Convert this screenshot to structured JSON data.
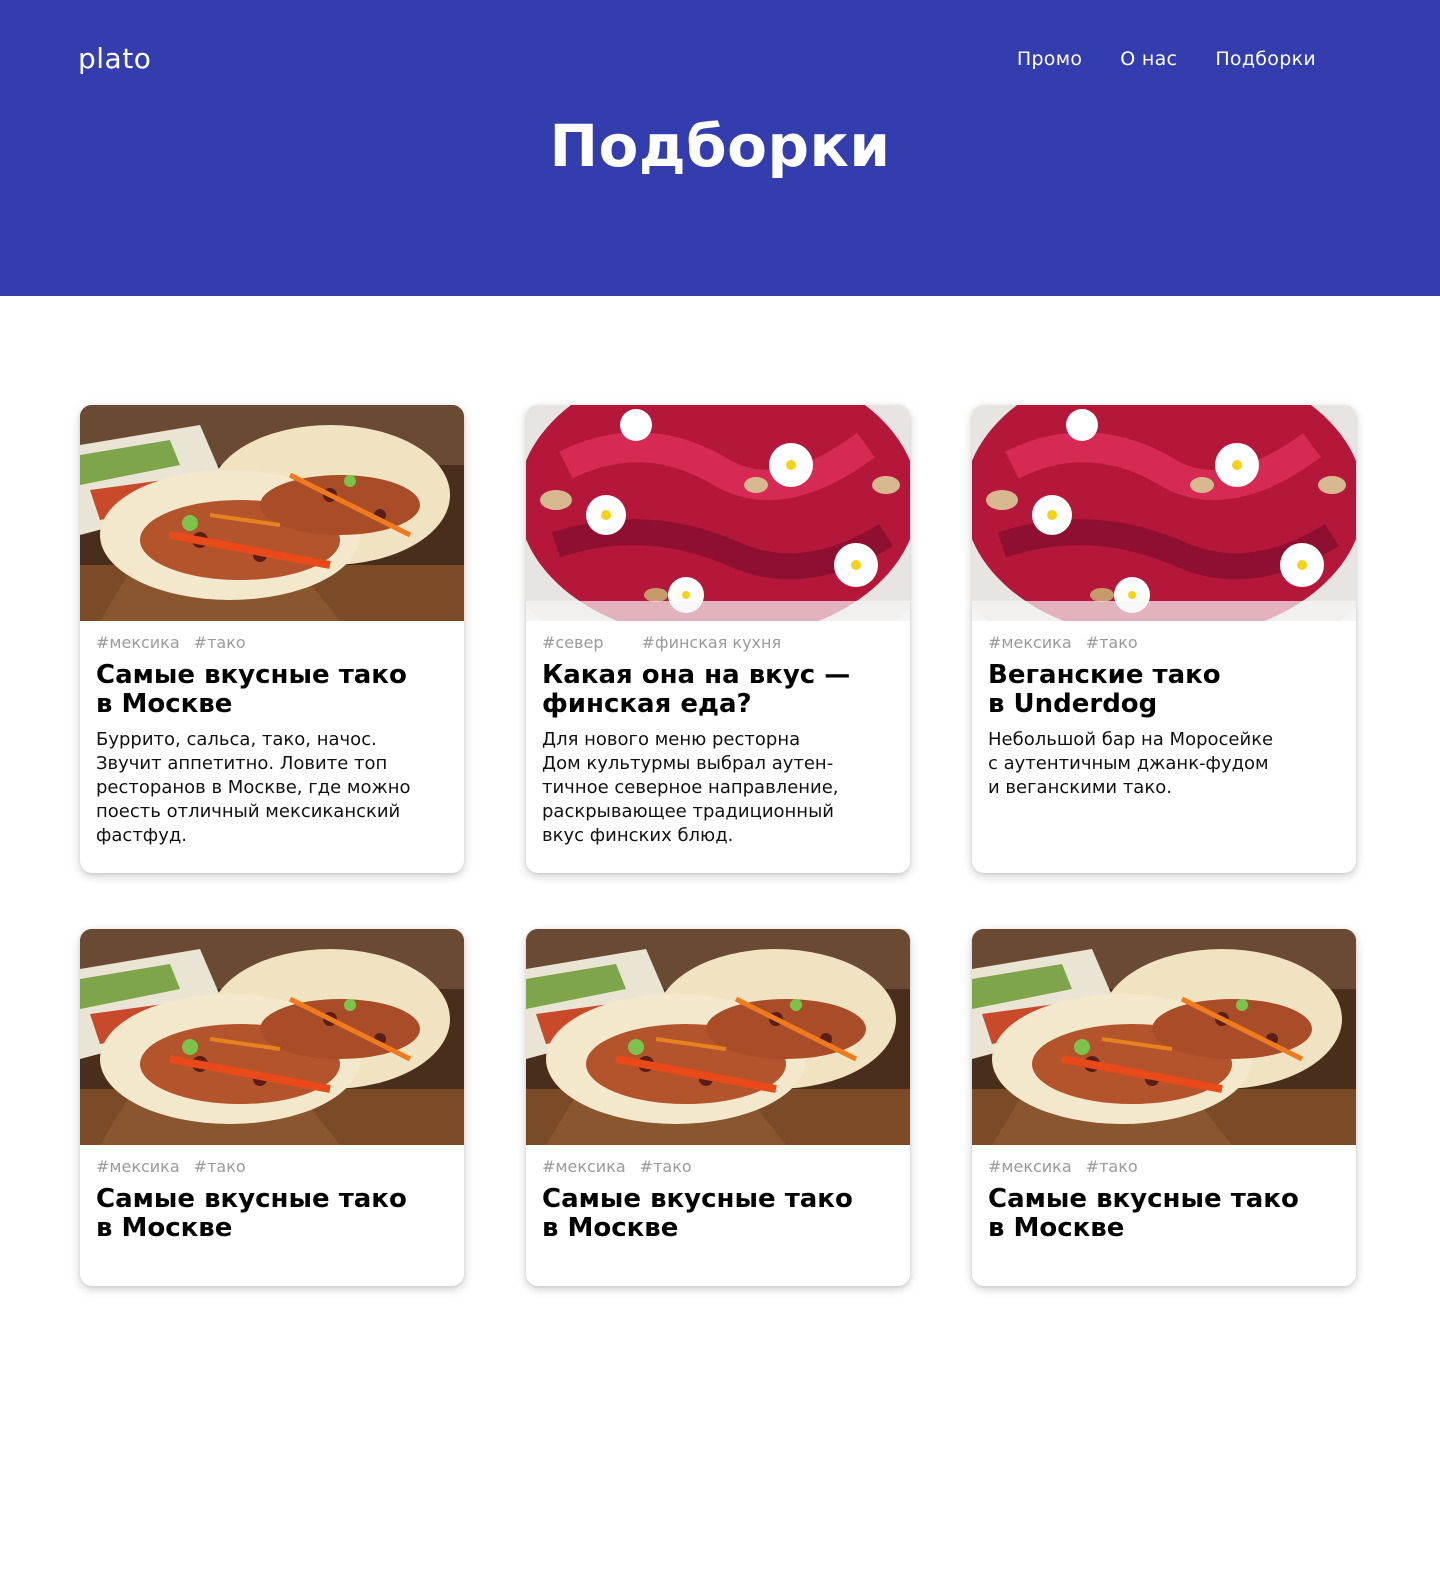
{
  "header": {
    "logo": "plato",
    "nav": [
      "Промо",
      "О нас",
      "Подборки"
    ],
    "title": "Подборки"
  },
  "cards": [
    {
      "image": "tacos-photo",
      "tags": [
        "#мексика",
        "#тако"
      ],
      "title": "Самые вкусные тако\nв Москве",
      "text": "Буррито, сальса, тако, начос.\nЗвучит аппетитно. Ловите топ\nресторанов в Москве, где можно\nпоесть отличный мексиканский\nфастфуд."
    },
    {
      "image": "finnish-dish-photo",
      "tags": [
        "#север",
        "#финская кухня"
      ],
      "title": "Какая она на вкус —\nфинская еда?",
      "text": "Для нового меню ресторна\nДом культурмы выбрал аутен-\nтичное северное направление,\nраскрывающее традиционный\nвкус финских блюд."
    },
    {
      "image": "finnish-dish-photo",
      "tags": [
        "#мексика",
        "#тако"
      ],
      "title": "Веганские тако\nв Underdog",
      "text": "Небольшой бар на Моросейке\nс аутентичным джанк-фудом\nи веганскими тако."
    },
    {
      "image": "tacos-photo",
      "tags": [
        "#мексика",
        "#тако"
      ],
      "title": "Самые вкусные тако\nв Москве",
      "text": ""
    },
    {
      "image": "tacos-photo",
      "tags": [
        "#мексика",
        "#тако"
      ],
      "title": "Самые вкусные тако\nв Москве",
      "text": ""
    },
    {
      "image": "tacos-photo",
      "tags": [
        "#мексика",
        "#тако"
      ],
      "title": "Самые вкусные тако\nв Москве",
      "text": ""
    }
  ]
}
